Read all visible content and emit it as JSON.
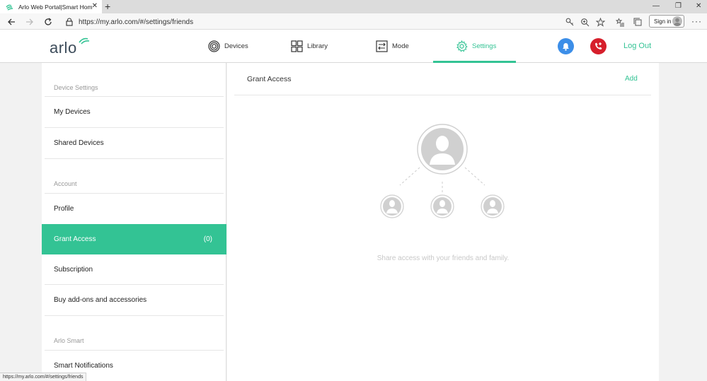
{
  "browser": {
    "tab_title": "Arlo Web Portal|Smart Home Se",
    "address_url": "https://my.arlo.com/#/settings/friends",
    "signin_label": "Sign in",
    "status_url": "https://my.arlo.com/#/settings/friends"
  },
  "header": {
    "logo_text": "arlo",
    "nav": [
      {
        "label": "Devices",
        "icon": "devices-icon"
      },
      {
        "label": "Library",
        "icon": "library-icon"
      },
      {
        "label": "Mode",
        "icon": "mode-icon"
      },
      {
        "label": "Settings",
        "icon": "gear-icon"
      }
    ],
    "active_nav": "Settings",
    "logout_label": "Log Out",
    "accent_color": "#33c394"
  },
  "sidebar": {
    "sections": [
      {
        "label": "Device Settings",
        "items": [
          "My Devices",
          "Shared Devices"
        ]
      },
      {
        "label": "Account",
        "items": [
          "Profile",
          "Grant Access",
          "Subscription",
          "Buy add-ons and accessories"
        ]
      },
      {
        "label": "Arlo Smart",
        "items": [
          "Smart Notifications"
        ]
      }
    ],
    "active_item": "Grant Access",
    "active_count": "(0)"
  },
  "content": {
    "title": "Grant Access",
    "add_label": "Add",
    "empty_message": "Share access with your friends and family."
  }
}
